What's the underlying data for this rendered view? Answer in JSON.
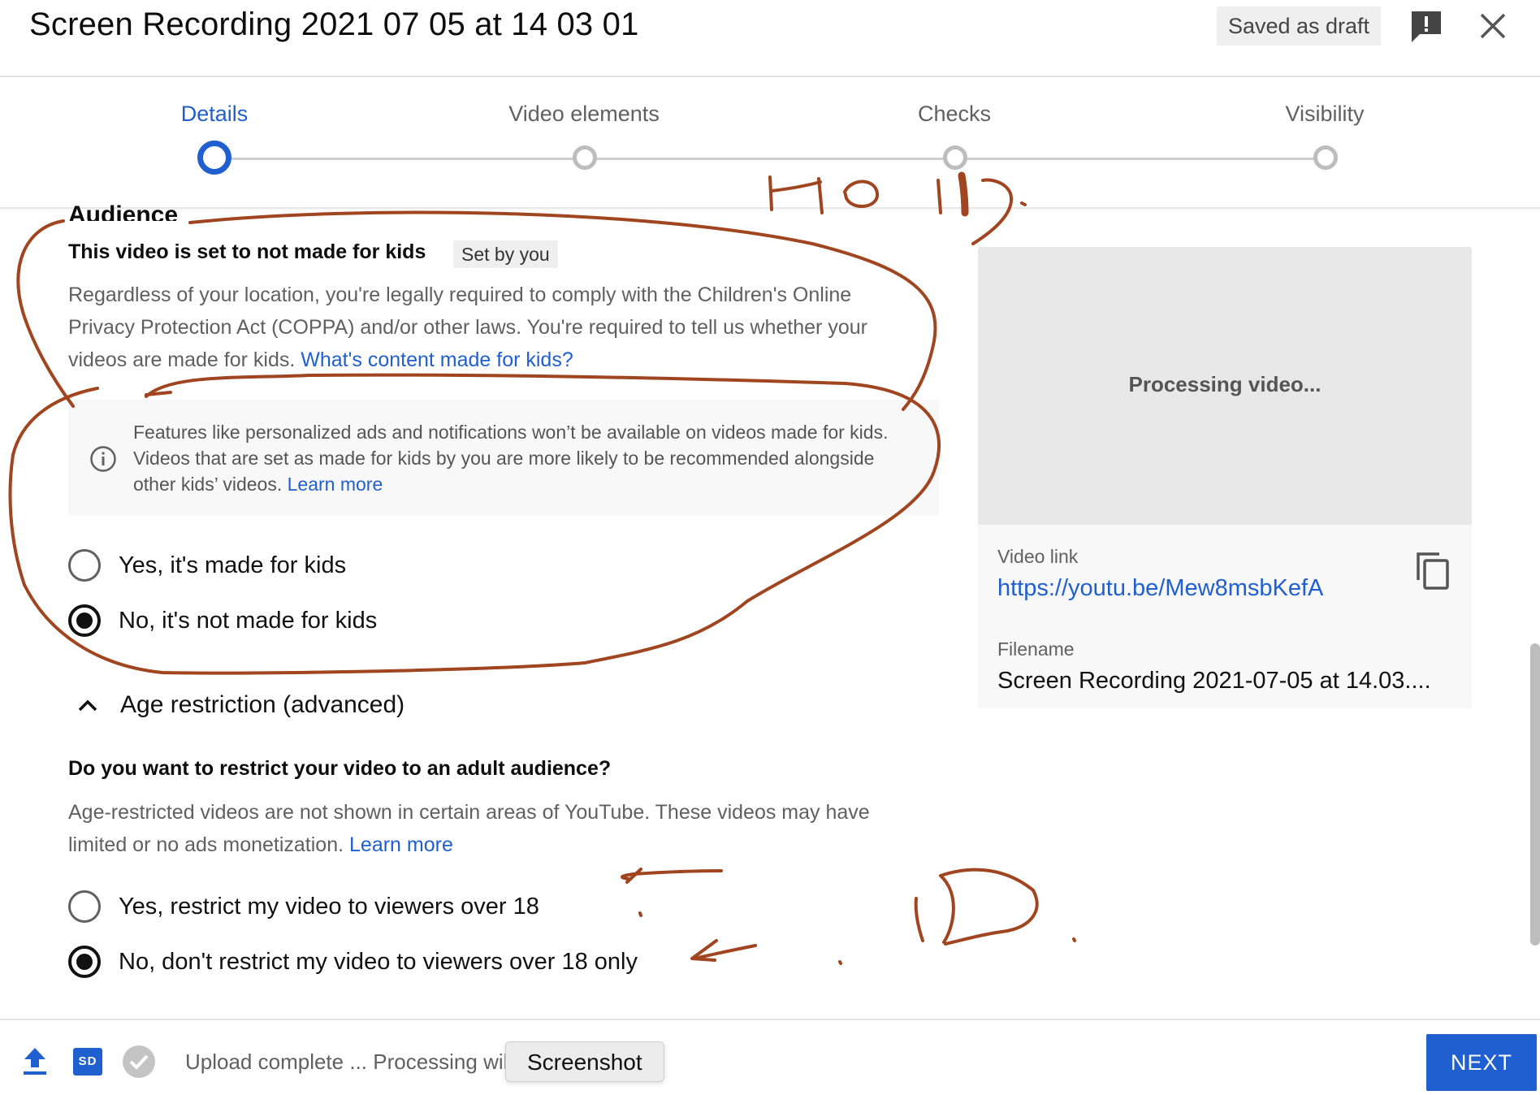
{
  "header": {
    "title": "Screen Recording 2021 07 05 at 14 03 01",
    "draft_badge": "Saved as draft"
  },
  "stepper": {
    "steps": [
      {
        "label": "Details",
        "active": true
      },
      {
        "label": "Video elements",
        "active": false
      },
      {
        "label": "Checks",
        "active": false
      },
      {
        "label": "Visibility",
        "active": false
      }
    ]
  },
  "audience": {
    "heading": "Audience",
    "kids_title": "This video is set to not made for kids",
    "set_by_badge": "Set by you",
    "description": "Regardless of your location, you're legally required to comply with the Children's Online Privacy Protection Act (COPPA) and/or other laws. You're required to tell us whether your videos are made for kids.",
    "description_link": "What's content made for kids?",
    "info_text": "Features like personalized ads and notifications won’t be available on videos made for kids. Videos that are set as made for kids by you are more likely to be recommended alongside other kids’ videos.",
    "info_link": "Learn more",
    "options": [
      {
        "label": "Yes, it's made for kids",
        "checked": false
      },
      {
        "label": "No, it's not made for kids",
        "checked": true
      }
    ]
  },
  "age_restriction": {
    "toggle_label": "Age restriction (advanced)",
    "question": "Do you want to restrict your video to an adult audience?",
    "description": "Age-restricted videos are not shown in certain areas of YouTube. These videos may have limited or no ads monetization.",
    "description_link": "Learn more",
    "options": [
      {
        "label": "Yes, restrict my video to viewers over 18",
        "checked": false
      },
      {
        "label": "No, don't restrict my video to viewers over 18 only",
        "checked": true
      }
    ]
  },
  "side_panel": {
    "preview_text": "Processing video...",
    "video_link_label": "Video link",
    "video_link": "https://youtu.be/Mew8msbKefA",
    "filename_label": "Filename",
    "filename": "Screen Recording 2021-07-05 at 14.03...."
  },
  "footer": {
    "status_text": "Upload complete ... Processing wil",
    "tooltip": "Screenshot",
    "sd_badge": "SD",
    "next_label": "NEXT"
  },
  "annotations": {
    "top_note": "NO ID.",
    "bottom_note": "ID."
  },
  "colors": {
    "accent": "#1f5fd0",
    "annotation_ink": "#a0451f"
  },
  "icons": [
    "feedback-icon",
    "close-icon",
    "info-icon",
    "chevron-up-icon",
    "copy-icon",
    "upload-icon",
    "sd-icon",
    "check-circle-icon"
  ]
}
